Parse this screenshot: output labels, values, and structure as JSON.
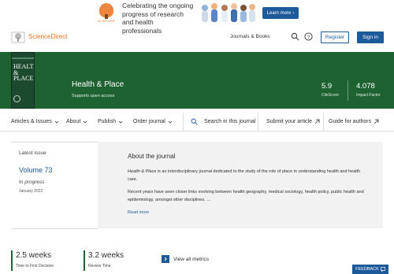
{
  "ad": {
    "brand": "ELSEVIER",
    "text": "Celebrating the ongoing progress of research and health professionals",
    "button": "Learn more"
  },
  "header": {
    "brand": "ScienceDirect",
    "journals_books": "Journals & Books",
    "register": "Register",
    "sign_in": "Sign in"
  },
  "journal": {
    "cover_title": "HEALTH & PLACE",
    "title": "Health & Place",
    "supports_prefix": "Supports ",
    "supports_emph": "open access",
    "citescore_value": "5.9",
    "citescore_label": "CiteScore",
    "impact_value": "4.078",
    "impact_label": "Impact Factor"
  },
  "nav": {
    "articles": "Articles & Issues",
    "about": "About",
    "publish": "Publish",
    "order": "Order journal",
    "search": "Search in this journal",
    "submit": "Submit your article",
    "guide": "Guide for authors"
  },
  "latest": {
    "label": "Latest issue",
    "volume": "Volume 73",
    "prefix": "In ",
    "status": "progress",
    "date": "January 2022"
  },
  "about": {
    "heading": "About the journal",
    "p1_emph": "Health & Place",
    "p1_rest": " is an interdisciplinary journal dedicated to the study of the role of place in understanding health and health care.",
    "p2": "Recent years have seen closer links evolving between health geography, medical sociology, health policy, public health and epidemiology, amongst other disciplines. …",
    "read_more": "Read more"
  },
  "metrics": {
    "first_decision_value": "2.5 weeks",
    "first_decision_label": "Time to First Decision",
    "review_value": "3.2 weeks",
    "review_label": "Review Time",
    "view_all": "View all metrics"
  },
  "feedback": "FEEDBACK",
  "colors": {
    "brand_green": "#1e6232",
    "link_blue": "#1d5a9a",
    "sd_orange": "#e9711c"
  }
}
